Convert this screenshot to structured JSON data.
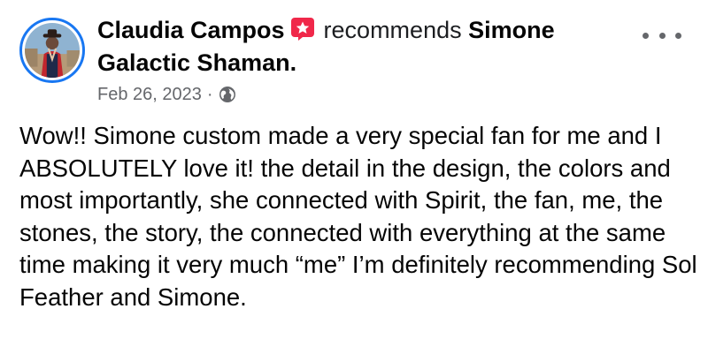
{
  "post": {
    "author": "Claudia Campos",
    "action": "recommends",
    "page_name_line1": "Simone",
    "page_name_line2": "Galactic Shaman.",
    "date": "Feb 26, 2023",
    "separator": "·",
    "privacy_icon": "globe-icon",
    "recommend_icon": "star-badge-icon",
    "more_icon": "more-options-icon",
    "accent_color": "#1877f2",
    "badge_color": "#f0284a",
    "text": "Wow!! Simone custom made a very special fan for me and I ABSOLUTELY love it! the detail in the design, the colors and most importantly, she connected with Spirit, the fan, me, the stones, the story, the connected with everything at the same time making it very much “me” I’m definitely recommending Sol Feather and Simone."
  }
}
